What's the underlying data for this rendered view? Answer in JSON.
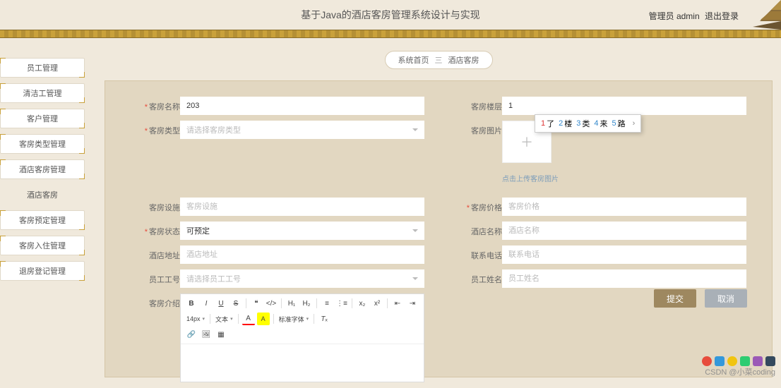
{
  "header": {
    "title": "基于Java的酒店客房管理系统设计与实现",
    "role_label": "管理员 admin",
    "logout": "退出登录"
  },
  "sidebar": {
    "items": [
      {
        "label": "员工管理"
      },
      {
        "label": "清洁工管理"
      },
      {
        "label": "客户管理"
      },
      {
        "label": "客房类型管理"
      },
      {
        "label": "酒店客房管理"
      },
      {
        "label": "酒店客房",
        "frameless": true
      },
      {
        "label": "客房预定管理"
      },
      {
        "label": "客房入住管理"
      },
      {
        "label": "退房登记管理"
      }
    ]
  },
  "breadcrumb": {
    "home": "系统首页",
    "sep": "三",
    "current": "酒店客房"
  },
  "form": {
    "room_name": {
      "label": "客房名称",
      "value": "203",
      "req": true
    },
    "room_floor": {
      "label": "客房楼层",
      "value": "1",
      "req": false
    },
    "room_type": {
      "label": "客房类型",
      "placeholder": "请选择客房类型",
      "req": true
    },
    "room_image": {
      "label": "客房图片",
      "hint": "点击上传客房图片",
      "req": false
    },
    "room_device": {
      "label": "客房设施",
      "placeholder": "客房设施",
      "req": false
    },
    "room_price": {
      "label": "客房价格",
      "placeholder": "客房价格",
      "req": true
    },
    "room_status": {
      "label": "客房状态",
      "value": "可预定",
      "req": true
    },
    "hotel_name": {
      "label": "酒店名称",
      "placeholder": "酒店名称",
      "req": false
    },
    "hotel_addr": {
      "label": "酒店地址",
      "placeholder": "酒店地址",
      "req": false
    },
    "contact_phone": {
      "label": "联系电话",
      "placeholder": "联系电话",
      "req": false
    },
    "staff_id": {
      "label": "员工工号",
      "placeholder": "请选择员工工号",
      "req": false
    },
    "staff_name": {
      "label": "员工姓名",
      "placeholder": "员工姓名",
      "req": false
    },
    "room_intro": {
      "label": "客房介绍"
    }
  },
  "editor": {
    "font_size": "14px",
    "font_family": "文本",
    "std_font": "标准字体"
  },
  "ime": {
    "candidates": [
      {
        "num": "1",
        "word": "了",
        "first": true
      },
      {
        "num": "2",
        "word": "楼"
      },
      {
        "num": "3",
        "word": "类"
      },
      {
        "num": "4",
        "word": "来"
      },
      {
        "num": "5",
        "word": "路"
      }
    ],
    "arrow": "›"
  },
  "actions": {
    "submit": "提交",
    "cancel": "取消"
  },
  "watermark": "CSDN @小菜coding"
}
